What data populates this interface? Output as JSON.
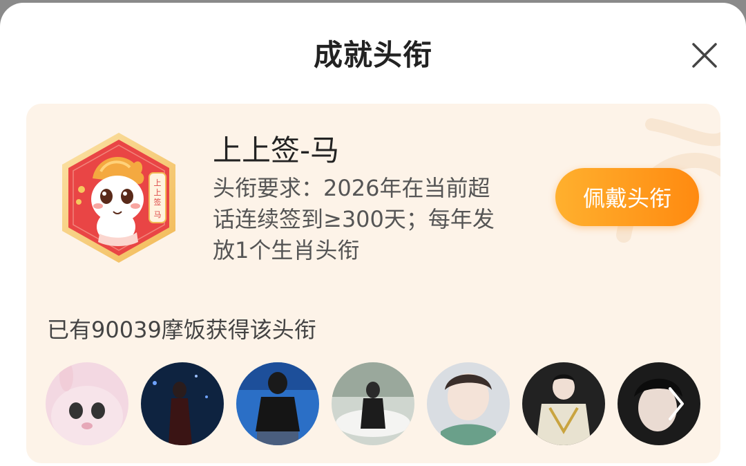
{
  "header": {
    "title": "成就头衔",
    "close_icon": "close-icon"
  },
  "title_card": {
    "badge_icon": "horse-mascot-badge",
    "badge_label": "上上签-马",
    "name": "上上签-马",
    "requirement_lines": [
      "头衔要求：2026年在当前超",
      "话连续签到≥300天；每年发",
      "放1个生肖头衔"
    ],
    "wear_button": "佩戴头衔",
    "owners_text": "已有90039摩饭获得该头衔",
    "avatar_count_shown": 7,
    "more_icon": "chevron-right-icon"
  },
  "colors": {
    "accent": "#ff9a1c",
    "card_bg": "#fdf3e8"
  }
}
